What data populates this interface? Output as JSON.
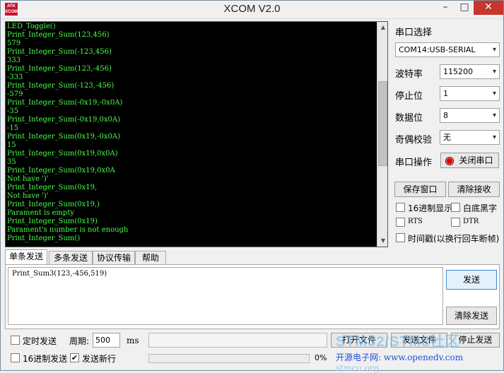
{
  "window": {
    "title": "XCOM V2.0",
    "logo_text": "ATK XCOM",
    "min_glyph": "–",
    "max_glyph": "□",
    "close_glyph": "✕"
  },
  "receive": {
    "lines": [
      "LED_Toggle()",
      "Print_Integer_Sum(123,456)",
      "579",
      "Print_Integer_Sum(-123,456)",
      "333",
      "Print_Integer_Sum(123,-456)",
      "-333",
      "Print_Integer_Sum(-123,-456)",
      "-579",
      "Print_Integer_Sum(-0x19,-0x0A)",
      "-35",
      "Print_Integer_Sum(-0x19,0x0A)",
      "-15",
      "Print_Integer_Sum(0x19,-0x0A)",
      "15",
      "Print_Integer_Sum(0x19,0x0A)",
      "35",
      "Print_Integer_Sum(0x19,0x0A",
      "Not have ')'",
      "Print_Integer_Sum(0x19,",
      "Not have ')'",
      "Print_Integer_Sum(0x19,)",
      "Parament is empty",
      "Print_Integer_Sum(0x19)",
      "Parament's number is not enough",
      "Print_Integer_Sum()"
    ]
  },
  "settings": {
    "port_select_label": "串口选择",
    "port_value": "COM14:USB-SERIAL",
    "baud_label": "波特率",
    "baud_value": "115200",
    "stopbits_label": "停止位",
    "stopbits_value": "1",
    "databits_label": "数据位",
    "databits_value": "8",
    "parity_label": "奇偶校验",
    "parity_value": "无",
    "port_op_label": "串口操作",
    "close_port_button": "关闭串口",
    "save_window_button": "保存窗口",
    "clear_receive_button": "清除接收",
    "hex_display_label": "16进制显示",
    "white_bg_label": "白底黑字",
    "rts_label": "RTS",
    "dtr_label": "DTR",
    "timestamp_label": "时间戳(以换行回车断帧)"
  },
  "tabs": [
    {
      "label": "单条发送"
    },
    {
      "label": "多条发送"
    },
    {
      "label": "协议传输"
    },
    {
      "label": "帮助"
    }
  ],
  "send": {
    "text": "Print_Sum3(123,-456,519)",
    "send_button": "发送",
    "clear_send_button": "清除发送"
  },
  "bottom": {
    "timed_send_label": "定时发送",
    "period_label": "周期:",
    "period_value": "500",
    "period_unit": "ms",
    "open_file_button": "打开文件",
    "send_file_button": "发送文件",
    "stop_send_button": "停止发送",
    "hex_send_label": "16进制发送",
    "newline_label": "发送新行",
    "progress_percent": "0%",
    "progress_value": 0
  },
  "footer": {
    "watermark": "STM32/STM8社区",
    "site_label": "开源电子网:",
    "site_url": "www.openedv.com",
    "ghost_url": "stmcu.org"
  },
  "checks": {
    "hex_display": false,
    "white_bg": false,
    "rts": false,
    "dtr": false,
    "timestamp": false,
    "timed_send": false,
    "hex_send": false,
    "newline": true,
    "check_glyph": "✔"
  },
  "colors": {
    "terminal_bg": "#000000",
    "terminal_text": "#4cff4c",
    "close_button": "#c7352c",
    "led_red": "#e00000"
  }
}
